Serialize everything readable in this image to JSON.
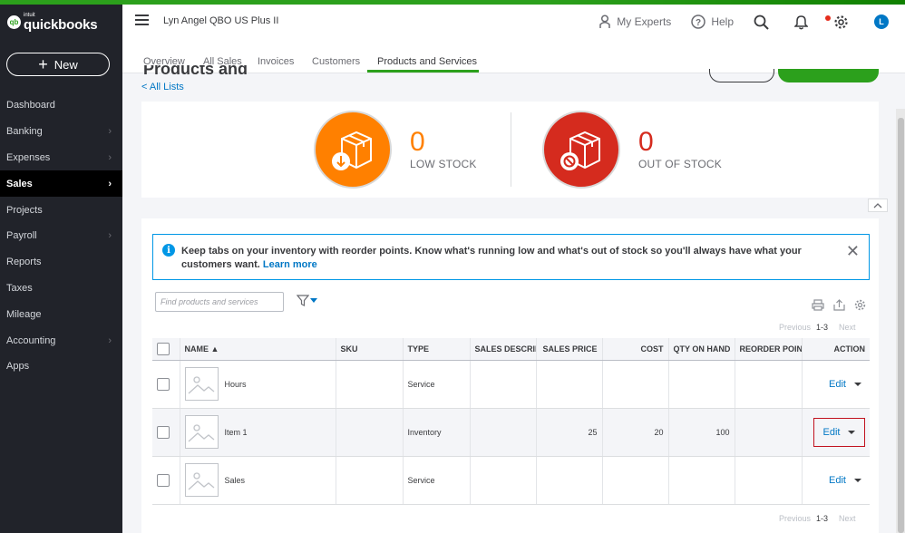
{
  "brand": {
    "intuit": "intuit",
    "name": "quickbooks",
    "badge": "qb"
  },
  "sidebar": {
    "new_label": "New",
    "items": [
      {
        "label": "Dashboard",
        "chevron": false,
        "active": false
      },
      {
        "label": "Banking",
        "chevron": true,
        "active": false
      },
      {
        "label": "Expenses",
        "chevron": true,
        "active": false
      },
      {
        "label": "Sales",
        "chevron": true,
        "active": true
      },
      {
        "label": "Projects",
        "chevron": false,
        "active": false
      },
      {
        "label": "Payroll",
        "chevron": true,
        "active": false
      },
      {
        "label": "Reports",
        "chevron": false,
        "active": false
      },
      {
        "label": "Taxes",
        "chevron": false,
        "active": false
      },
      {
        "label": "Mileage",
        "chevron": false,
        "active": false
      },
      {
        "label": "Accounting",
        "chevron": true,
        "active": false
      },
      {
        "label": "Apps",
        "chevron": false,
        "active": false
      }
    ]
  },
  "header": {
    "company": "Lyn Angel QBO US Plus II",
    "my_experts": "My Experts",
    "help": "Help",
    "avatar_initial": "L"
  },
  "tabs": [
    {
      "label": "Overview"
    },
    {
      "label": "All Sales"
    },
    {
      "label": "Invoices"
    },
    {
      "label": "Customers"
    },
    {
      "label": "Products and Services",
      "active": true
    }
  ],
  "page": {
    "title": "Products and Services",
    "back_link": "< All Lists"
  },
  "stock": {
    "low": {
      "count": "0",
      "label": "LOW STOCK"
    },
    "out": {
      "count": "0",
      "label": "OUT OF STOCK"
    }
  },
  "banner": {
    "text": "Keep tabs on your inventory with reorder points. Know what's running low and what's out of stock so you'll always have what your customers want.",
    "link": "Learn more"
  },
  "search": {
    "placeholder": "Find products and services"
  },
  "pager": {
    "prev": "Previous",
    "range": "1-3",
    "next": "Next"
  },
  "table": {
    "columns": [
      "NAME ▲",
      "SKU",
      "TYPE",
      "SALES DESCRIPTION",
      "SALES PRICE",
      "COST",
      "QTY ON HAND",
      "REORDER POINT",
      "ACTION"
    ],
    "rows": [
      {
        "name": "Hours",
        "sku": "",
        "type": "Service",
        "desc": "",
        "price": "",
        "cost": "",
        "qty": "",
        "reorder": "",
        "action": "Edit"
      },
      {
        "name": "Item 1",
        "sku": "",
        "type": "Inventory",
        "desc": "",
        "price": "25",
        "cost": "20",
        "qty": "100",
        "reorder": "",
        "action": "Edit"
      },
      {
        "name": "Sales",
        "sku": "",
        "type": "Service",
        "desc": "",
        "price": "",
        "cost": "",
        "qty": "",
        "reorder": "",
        "action": "Edit"
      }
    ]
  },
  "colors": {
    "brand_green": "#2ca01c",
    "sidebar_bg": "#21232a",
    "link_blue": "#0077c5",
    "low_stock": "#ff8000",
    "out_of_stock": "#d52b1e",
    "highlight_border": "#c1121f"
  }
}
